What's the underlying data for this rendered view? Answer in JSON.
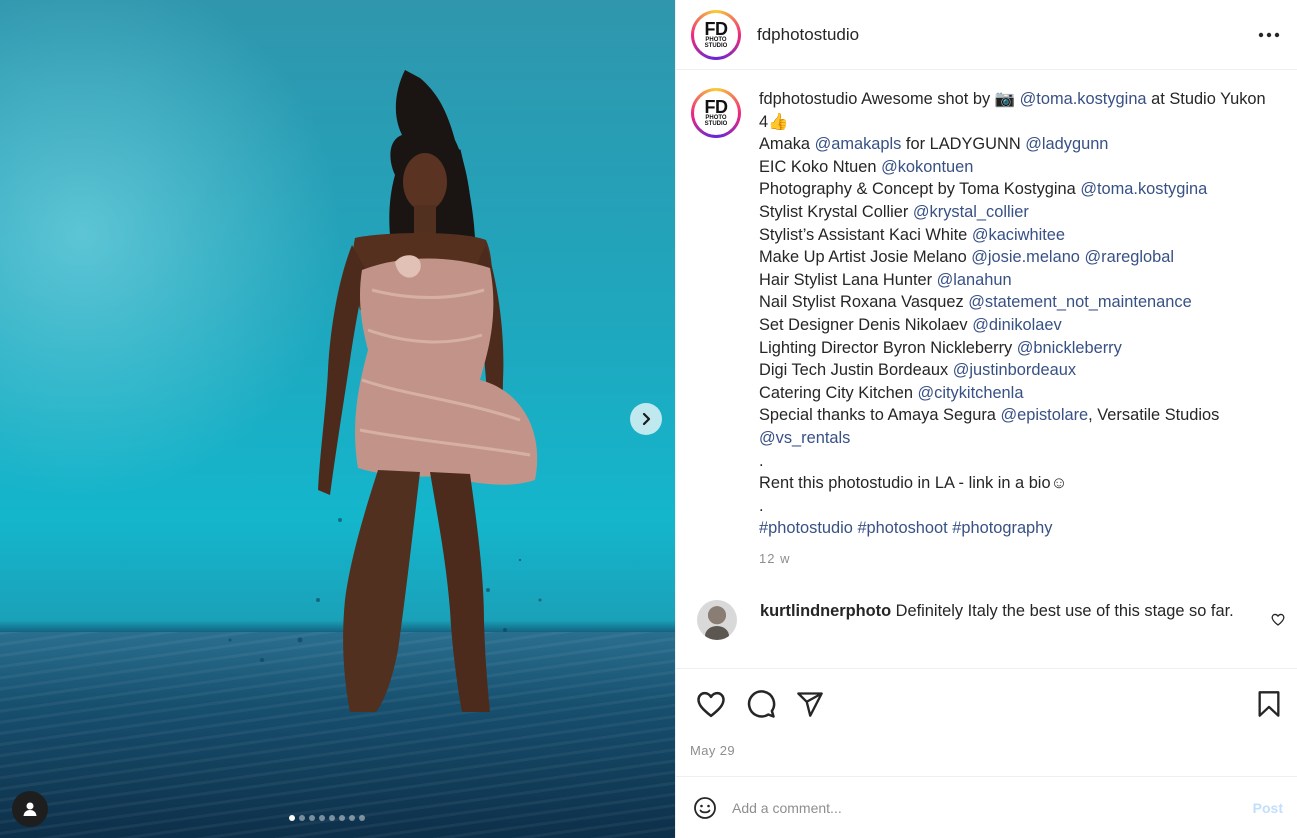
{
  "post": {
    "username": "fdphotostudio",
    "avatar_text": {
      "big": "FD",
      "small": "PHOTO STUDIO"
    },
    "caption": {
      "intro": [
        {
          "text": " Awesome shot by 📷 "
        },
        {
          "text": "@toma.kostygina",
          "mention": true
        },
        {
          "text": " at Studio Yukon 4👍"
        }
      ],
      "credit_lines": [
        [
          {
            "text": "Amaka "
          },
          {
            "text": "@amakapls",
            "mention": true
          },
          {
            "text": " for LADYGUNN "
          },
          {
            "text": "@ladygunn",
            "mention": true
          }
        ],
        [
          {
            "text": "EIC Koko Ntuen "
          },
          {
            "text": "@kokontuen",
            "mention": true
          }
        ],
        [
          {
            "text": "Photography & Concept by Toma Kostygina "
          },
          {
            "text": "@toma.kostygina",
            "mention": true
          }
        ],
        [
          {
            "text": "Stylist Krystal Collier "
          },
          {
            "text": "@krystal_collier",
            "mention": true
          }
        ],
        [
          {
            "text": "Stylist’s Assistant Kaci White "
          },
          {
            "text": "@kaciwhitee",
            "mention": true
          }
        ],
        [
          {
            "text": "Make Up Artist Josie Melano "
          },
          {
            "text": "@josie.melano",
            "mention": true
          },
          {
            "text": " "
          },
          {
            "text": "@rareglobal",
            "mention": true
          }
        ],
        [
          {
            "text": "Hair Stylist Lana Hunter "
          },
          {
            "text": "@lanahun",
            "mention": true
          }
        ],
        [
          {
            "text": "Nail Stylist Roxana Vasquez "
          },
          {
            "text": "@statement_not_maintenance",
            "mention": true
          }
        ],
        [
          {
            "text": "Set Designer Denis Nikolaev "
          },
          {
            "text": "@dinikolaev",
            "mention": true
          }
        ],
        [
          {
            "text": "Lighting Director Byron Nickleberry "
          },
          {
            "text": "@bnickleberry",
            "mention": true
          }
        ],
        [
          {
            "text": "Digi Tech Justin Bordeaux "
          },
          {
            "text": "@justinbordeaux",
            "mention": true
          }
        ],
        [
          {
            "text": "Catering City Kitchen "
          },
          {
            "text": "@citykitchenla",
            "mention": true
          }
        ],
        [
          {
            "text": "Special thanks to Amaya Segura "
          },
          {
            "text": "@epistolare",
            "mention": true
          },
          {
            "text": ", Versatile Studios "
          },
          {
            "text": "@vs_rentals",
            "mention": true
          }
        ],
        [
          {
            "text": "."
          }
        ],
        [
          {
            "text": "Rent this photostudio in LA - link in a bio☺"
          }
        ],
        [
          {
            "text": "."
          }
        ],
        [
          {
            "text": "#photostudio",
            "mention": true
          },
          {
            "text": " "
          },
          {
            "text": "#photoshoot",
            "mention": true
          },
          {
            "text": " "
          },
          {
            "text": "#photography",
            "mention": true
          }
        ]
      ],
      "age": "12 w"
    },
    "comment": {
      "username": "kurtlindnerphoto",
      "text": " Definitely Italy the best use of this stage so far."
    },
    "date": "May 29",
    "add_comment": {
      "placeholder": "Add a comment...",
      "post_label": "Post"
    },
    "carousel": {
      "total": 8,
      "active_index": 0
    }
  },
  "icons": {
    "more": "more-options-icon",
    "next": "chevron-right-icon",
    "user_tag": "person-icon",
    "like": "heart-icon",
    "comment": "speech-bubble-icon",
    "share": "paper-plane-icon",
    "save": "bookmark-icon",
    "emoji": "smiley-icon",
    "comment_like": "heart-icon"
  },
  "colors": {
    "mention": "#385185",
    "meta": "#8e8e8e",
    "post_button": "#c0dffd"
  }
}
